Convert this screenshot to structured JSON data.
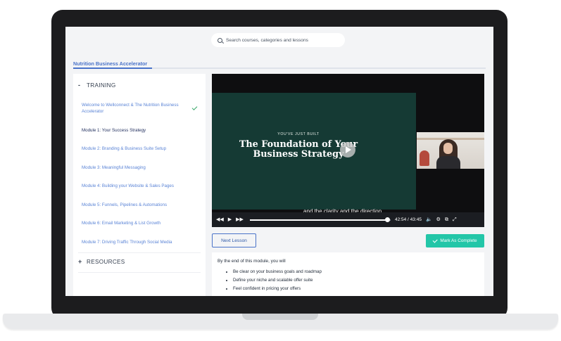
{
  "search": {
    "placeholder": "Search courses, categories and lessons"
  },
  "breadcrumb": {
    "course_title": "Nutrition Business Accelerator"
  },
  "sidebar": {
    "training_label": "TRAINING",
    "training_symbol": "-",
    "lessons": [
      {
        "title": "Welcome to Wellconnect & The Nutrition Business Accelerator",
        "completed": true
      },
      {
        "title": "Module 1: Your Success Strategy",
        "active": true
      },
      {
        "title": "Module 2: Branding & Business Suite Setup"
      },
      {
        "title": "Module 3: Meaningful Messaging"
      },
      {
        "title": "Module 4: Building your Website & Sales Pages"
      },
      {
        "title": "Module 5: Funnels, Pipelines & Automations"
      },
      {
        "title": "Module 6: Email Marketing & List Growth"
      },
      {
        "title": "Module 7: Driving Traffic Through Social Media"
      }
    ],
    "resources_label": "RESOURCES",
    "resources_symbol": "+"
  },
  "video": {
    "kicker": "YOU'VE JUST BUILT",
    "title_line1": "The Foundation of Your",
    "title_line2": "Business Strategy",
    "caption": "and the clarity and the direction",
    "current_time": "42:54",
    "time_separator": "/",
    "duration": "43:45",
    "progress_fraction": 0.98
  },
  "actions": {
    "next_lesson": "Next Lesson",
    "mark_complete": "Mark As Complete"
  },
  "description": {
    "intro": "By the end of this module, you will",
    "bullets": [
      "Be clear on your business goals and roadmap",
      "Define your niche and scalable offer suite",
      "Feel confident in pricing your offers"
    ]
  },
  "colors": {
    "accent": "#4a73c9",
    "success": "#23c6a8",
    "slide_bg": "#153a34"
  }
}
